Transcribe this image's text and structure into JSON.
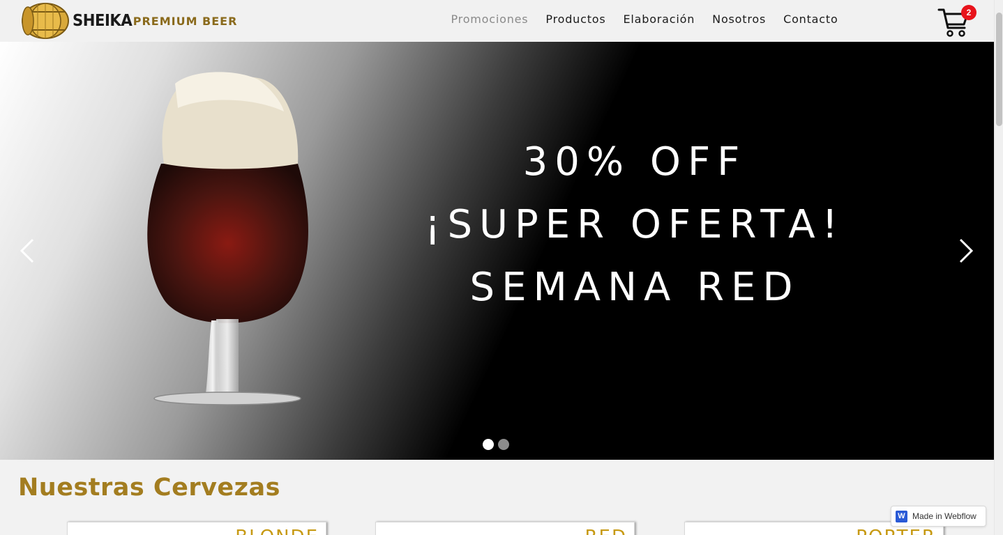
{
  "header": {
    "brand": "SHEIKA",
    "brand_sub": "PREMIUM BEER",
    "nav": [
      {
        "label": "Promociones",
        "active": true
      },
      {
        "label": "Productos",
        "active": false
      },
      {
        "label": "Elaboración",
        "active": false
      },
      {
        "label": "Nosotros",
        "active": false
      },
      {
        "label": "Contacto",
        "active": false
      }
    ],
    "cart_icon": "shopping-cart-icon",
    "cart_count": "2"
  },
  "slider": {
    "lines": [
      "30% OFF",
      "¡SUPER OFERTA!",
      "SEMANA RED"
    ],
    "prev_icon": "chevron-left-icon",
    "next_icon": "chevron-right-icon",
    "dot_count": 2,
    "active_dot": 1
  },
  "section": {
    "title": "Nuestras Cervezas",
    "cards": [
      {
        "label": "BLONDE"
      },
      {
        "label": "RED"
      },
      {
        "label": "PORTER"
      }
    ]
  },
  "webflow_badge": {
    "label": "Made in Webflow",
    "icon_letter": "W"
  },
  "colors": {
    "accent_gold": "#a37d20",
    "card_label": "#c79a14",
    "badge_red": "#e8131b"
  }
}
